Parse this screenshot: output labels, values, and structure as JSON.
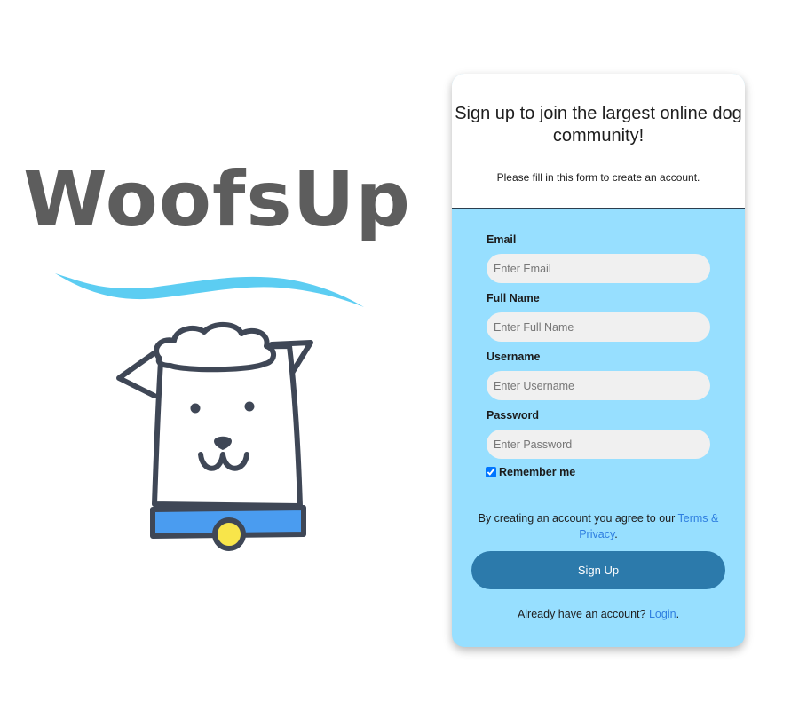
{
  "brand": {
    "name": "WoofsUp",
    "accent_color": "#5ccdf2",
    "collar_color": "#4a9cf0",
    "tag_color": "#f8e54a"
  },
  "signup": {
    "title": "Sign up to join the largest online dog community!",
    "subtitle": "Please fill in this form to create an account.",
    "fields": [
      {
        "label": "Email",
        "placeholder": "Enter Email",
        "value": ""
      },
      {
        "label": "Full Name",
        "placeholder": "Enter Full Name",
        "value": ""
      },
      {
        "label": "Username",
        "placeholder": "Enter Username",
        "value": ""
      },
      {
        "label": "Password",
        "placeholder": "Enter Password",
        "value": ""
      }
    ],
    "remember_label": "Remember me",
    "remember_checked": true,
    "terms_prefix": "By creating an account you agree to our ",
    "terms_link": "Terms & Privacy",
    "terms_suffix": ".",
    "submit_label": "Sign Up",
    "login_prefix": "Already have an account? ",
    "login_link": "Login",
    "login_suffix": ".",
    "card_color": "#97dfff",
    "button_color": "#2c7aab",
    "link_color": "#2e7ee0"
  }
}
